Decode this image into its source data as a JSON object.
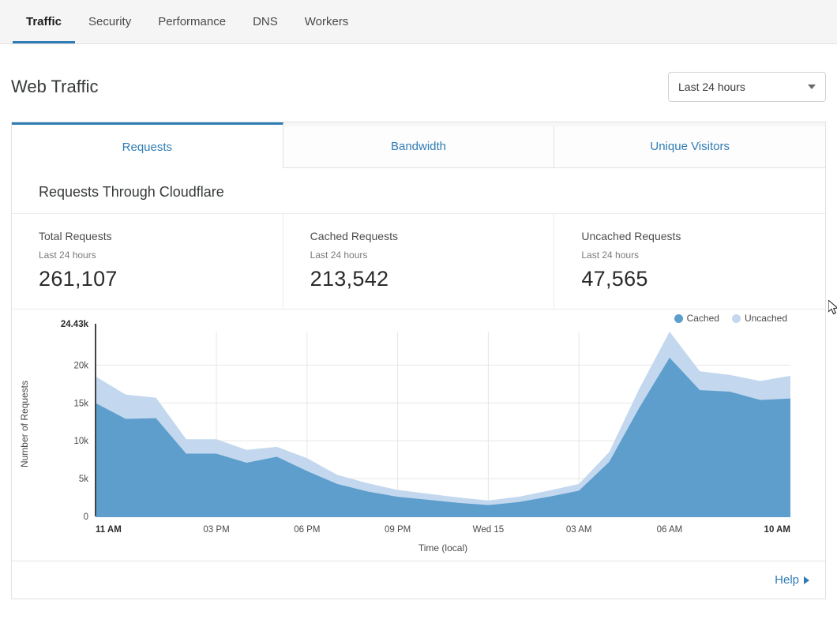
{
  "topnav": {
    "items": [
      {
        "label": "Traffic",
        "active": true
      },
      {
        "label": "Security",
        "active": false
      },
      {
        "label": "Performance",
        "active": false
      },
      {
        "label": "DNS",
        "active": false
      },
      {
        "label": "Workers",
        "active": false
      }
    ]
  },
  "header": {
    "title": "Web Traffic",
    "period_value": "Last 24 hours"
  },
  "tabs": [
    {
      "label": "Requests",
      "active": true
    },
    {
      "label": "Bandwidth",
      "active": false
    },
    {
      "label": "Unique Visitors",
      "active": false
    }
  ],
  "section": {
    "title": "Requests Through Cloudflare"
  },
  "metrics": [
    {
      "label": "Total Requests",
      "sub": "Last 24 hours",
      "value": "261,107"
    },
    {
      "label": "Cached Requests",
      "sub": "Last 24 hours",
      "value": "213,542"
    },
    {
      "label": "Uncached Requests",
      "sub": "Last 24 hours",
      "value": "47,565"
    }
  ],
  "footer": {
    "help_label": "Help"
  },
  "colors": {
    "cached": "#5d9ecd",
    "uncached": "#c3d8ee",
    "accent": "#2f7cb5",
    "axis": "#4a4a4a",
    "grid": "#e6e6e6"
  },
  "chart_data": {
    "type": "area",
    "stacked": true,
    "title": "",
    "xlabel": "Time (local)",
    "ylabel": "Number of Requests",
    "ylim": [
      0,
      24430
    ],
    "y_ticks": [
      "0",
      "5k",
      "10k",
      "15k",
      "20k"
    ],
    "y_max_label": "24.43k",
    "grid": true,
    "legend_position": "top-right",
    "x_tick_labels": [
      "11 AM",
      "03 PM",
      "06 PM",
      "09 PM",
      "Wed 15",
      "03 AM",
      "06 AM",
      "10 AM"
    ],
    "x_tick_indices": [
      0,
      4,
      7,
      10,
      13,
      16,
      19,
      23
    ],
    "x": [
      "11 AM",
      "12 PM",
      "01 PM",
      "02 PM",
      "03 PM",
      "04 PM",
      "05 PM",
      "06 PM",
      "07 PM",
      "08 PM",
      "09 PM",
      "10 PM",
      "11 PM",
      "Wed 15",
      "01 AM",
      "02 AM",
      "03 AM",
      "04 AM",
      "05 AM",
      "06 AM",
      "07 AM",
      "08 AM",
      "09 AM",
      "10 AM"
    ],
    "series": [
      {
        "name": "Cached",
        "color": "#5d9ecd",
        "values": [
          15000,
          12900,
          13000,
          8300,
          8300,
          7100,
          7900,
          6000,
          4300,
          3300,
          2600,
          2200,
          1800,
          1500,
          1900,
          2600,
          3400,
          7200,
          14400,
          21000,
          16700,
          16500,
          15400,
          15600
        ]
      },
      {
        "name": "Uncached",
        "color": "#c3d8ee",
        "values": [
          3500,
          3200,
          2700,
          1900,
          1900,
          1700,
          1300,
          1700,
          1200,
          1100,
          900,
          800,
          700,
          600,
          700,
          800,
          900,
          1300,
          2500,
          3430,
          2500,
          2200,
          2500,
          3000
        ]
      }
    ]
  }
}
